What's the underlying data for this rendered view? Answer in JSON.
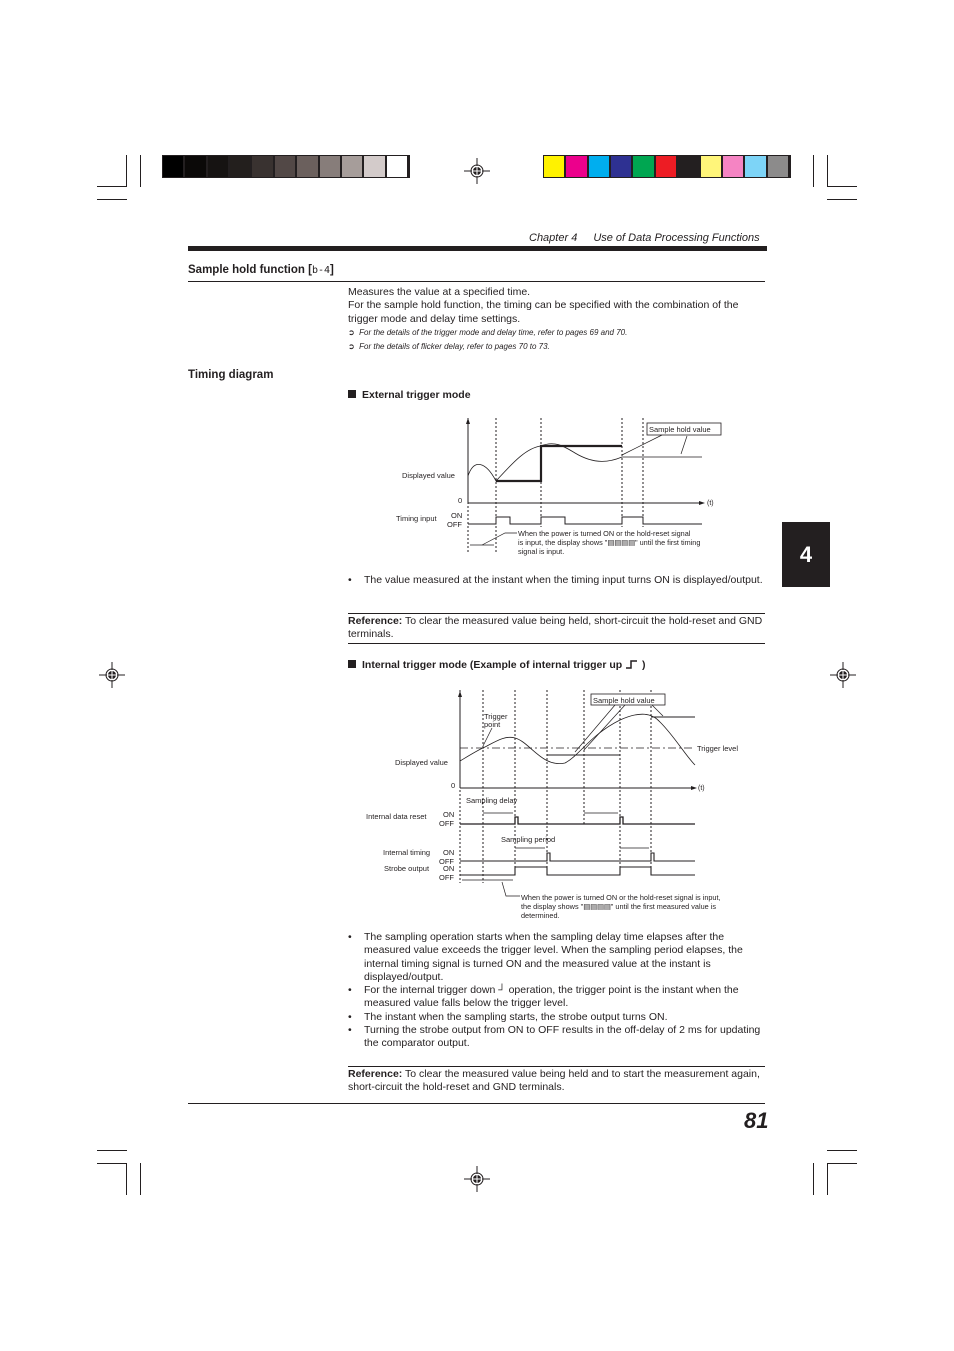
{
  "print_marks": {
    "gray_swatches": [
      "#000000",
      "#0b0908",
      "#161312",
      "#231f1d",
      "#393230",
      "#524846",
      "#6b605d",
      "#877d7a",
      "#a69d9a",
      "#d3cbca",
      "#ffffff"
    ],
    "color_swatches": [
      "#fff200",
      "#ec008c",
      "#00aeef",
      "#2e3192",
      "#00a651",
      "#ed1c24",
      "#231f20",
      "#fff57a",
      "#f584c3",
      "#7dd4f7",
      "#8c8b8b"
    ]
  },
  "header": {
    "chapter": "Chapter 4",
    "chapter_title": "Use of Data Processing Functions"
  },
  "section": {
    "title": "Sample hold function [",
    "title_code": "b-4",
    "title_end": "]",
    "intro_line1": "Measures the value at a specified time.",
    "intro_line2": "For the sample hold function, the timing can be specified with the combination of the trigger mode and delay time settings.",
    "refs": [
      "For the details of the trigger mode and delay time, refer to pages 69 and 70.",
      "For the details of flicker delay, refer to pages 70 to 73."
    ],
    "ref_arrow_icon": "➲"
  },
  "timing": {
    "heading": "Timing diagram",
    "external": {
      "heading": "External trigger mode",
      "labels": {
        "displayed_value": "Displayed value",
        "zero": "0",
        "t": "(t)",
        "sample_hold_value": "Sample hold value",
        "timing_input": "Timing input",
        "on": "ON",
        "off": "OFF",
        "note": [
          "When the power is turned ON or the hold-reset signal",
          "is input, the display shows \"▤▤▤▤\" until the first timing",
          "signal is input."
        ]
      },
      "bullets": [
        "The value measured at the instant when the timing input turns ON is displayed/output."
      ],
      "reference_label": "Reference:",
      "reference_text": " To clear the measured value being held, short-circuit the hold-reset and GND terminals."
    },
    "internal": {
      "heading": "Internal trigger mode (Example of internal trigger up",
      "heading_end": " )",
      "labels": {
        "trigger_point_1": "Trigger",
        "trigger_point_2": "point",
        "sample_hold_value": "Sample hold value",
        "trigger_level": "Trigger level",
        "displayed_value": "Displayed value",
        "zero": "0",
        "t": "(t)",
        "sampling_delay": "Sampling delay",
        "internal_data_reset": "Internal data reset",
        "sampling_period": "Sampling period",
        "internal_timing": "Internal timing",
        "strobe_output": "Strobe output",
        "on": "ON",
        "off": "OFF",
        "note": [
          "When the power is turned ON or the hold-reset signal is input,",
          "the display shows \"▤▤▤▤\" until the first measured value is",
          "determined."
        ]
      },
      "bullets": [
        "The sampling operation starts when the sampling delay time elapses after the measured value exceeds the trigger level. When the sampling period elapses, the internal timing signal is turned ON and the measured value at the instant is displayed/output.",
        "For the internal trigger down ┘ operation, the trigger point is the instant when the measured value falls below the trigger level.",
        "The instant when the sampling starts, the strobe output turns ON.",
        "Turning the strobe output from ON to OFF results in the off-delay of 2 ms for updating the comparator output."
      ],
      "reference_label": "Reference:",
      "reference_text": " To clear the measured value being held and to start the measurement again, short-circuit the hold-reset and GND terminals."
    }
  },
  "side_tab": "4",
  "page_number": "81"
}
